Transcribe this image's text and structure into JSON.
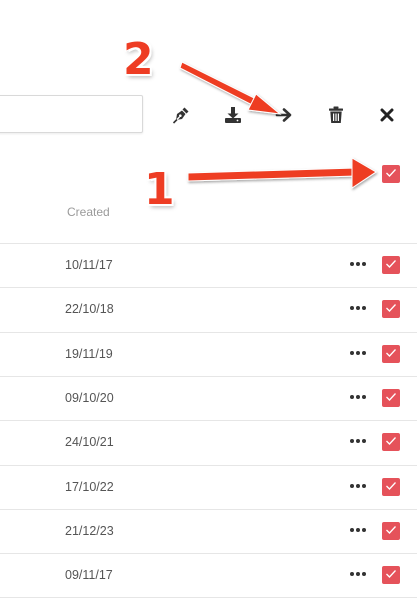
{
  "toolbar": {
    "icons": [
      "pen-icon",
      "download-icon",
      "arrow-right-icon",
      "trash-icon",
      "close-icon"
    ]
  },
  "table": {
    "header": {
      "created": "Created"
    },
    "rows": [
      {
        "created": "10/11/17",
        "checked": true
      },
      {
        "created": "22/10/18",
        "checked": true
      },
      {
        "created": "19/11/19",
        "checked": true
      },
      {
        "created": "09/10/20",
        "checked": true
      },
      {
        "created": "24/10/21",
        "checked": true
      },
      {
        "created": "17/10/22",
        "checked": true
      },
      {
        "created": "21/12/23",
        "checked": true
      },
      {
        "created": "09/11/17",
        "checked": true
      }
    ]
  },
  "annotations": {
    "label_1": "1",
    "label_2": "2"
  },
  "colors": {
    "checkbox": "#e5525a",
    "annotation": "#ee3d24"
  }
}
